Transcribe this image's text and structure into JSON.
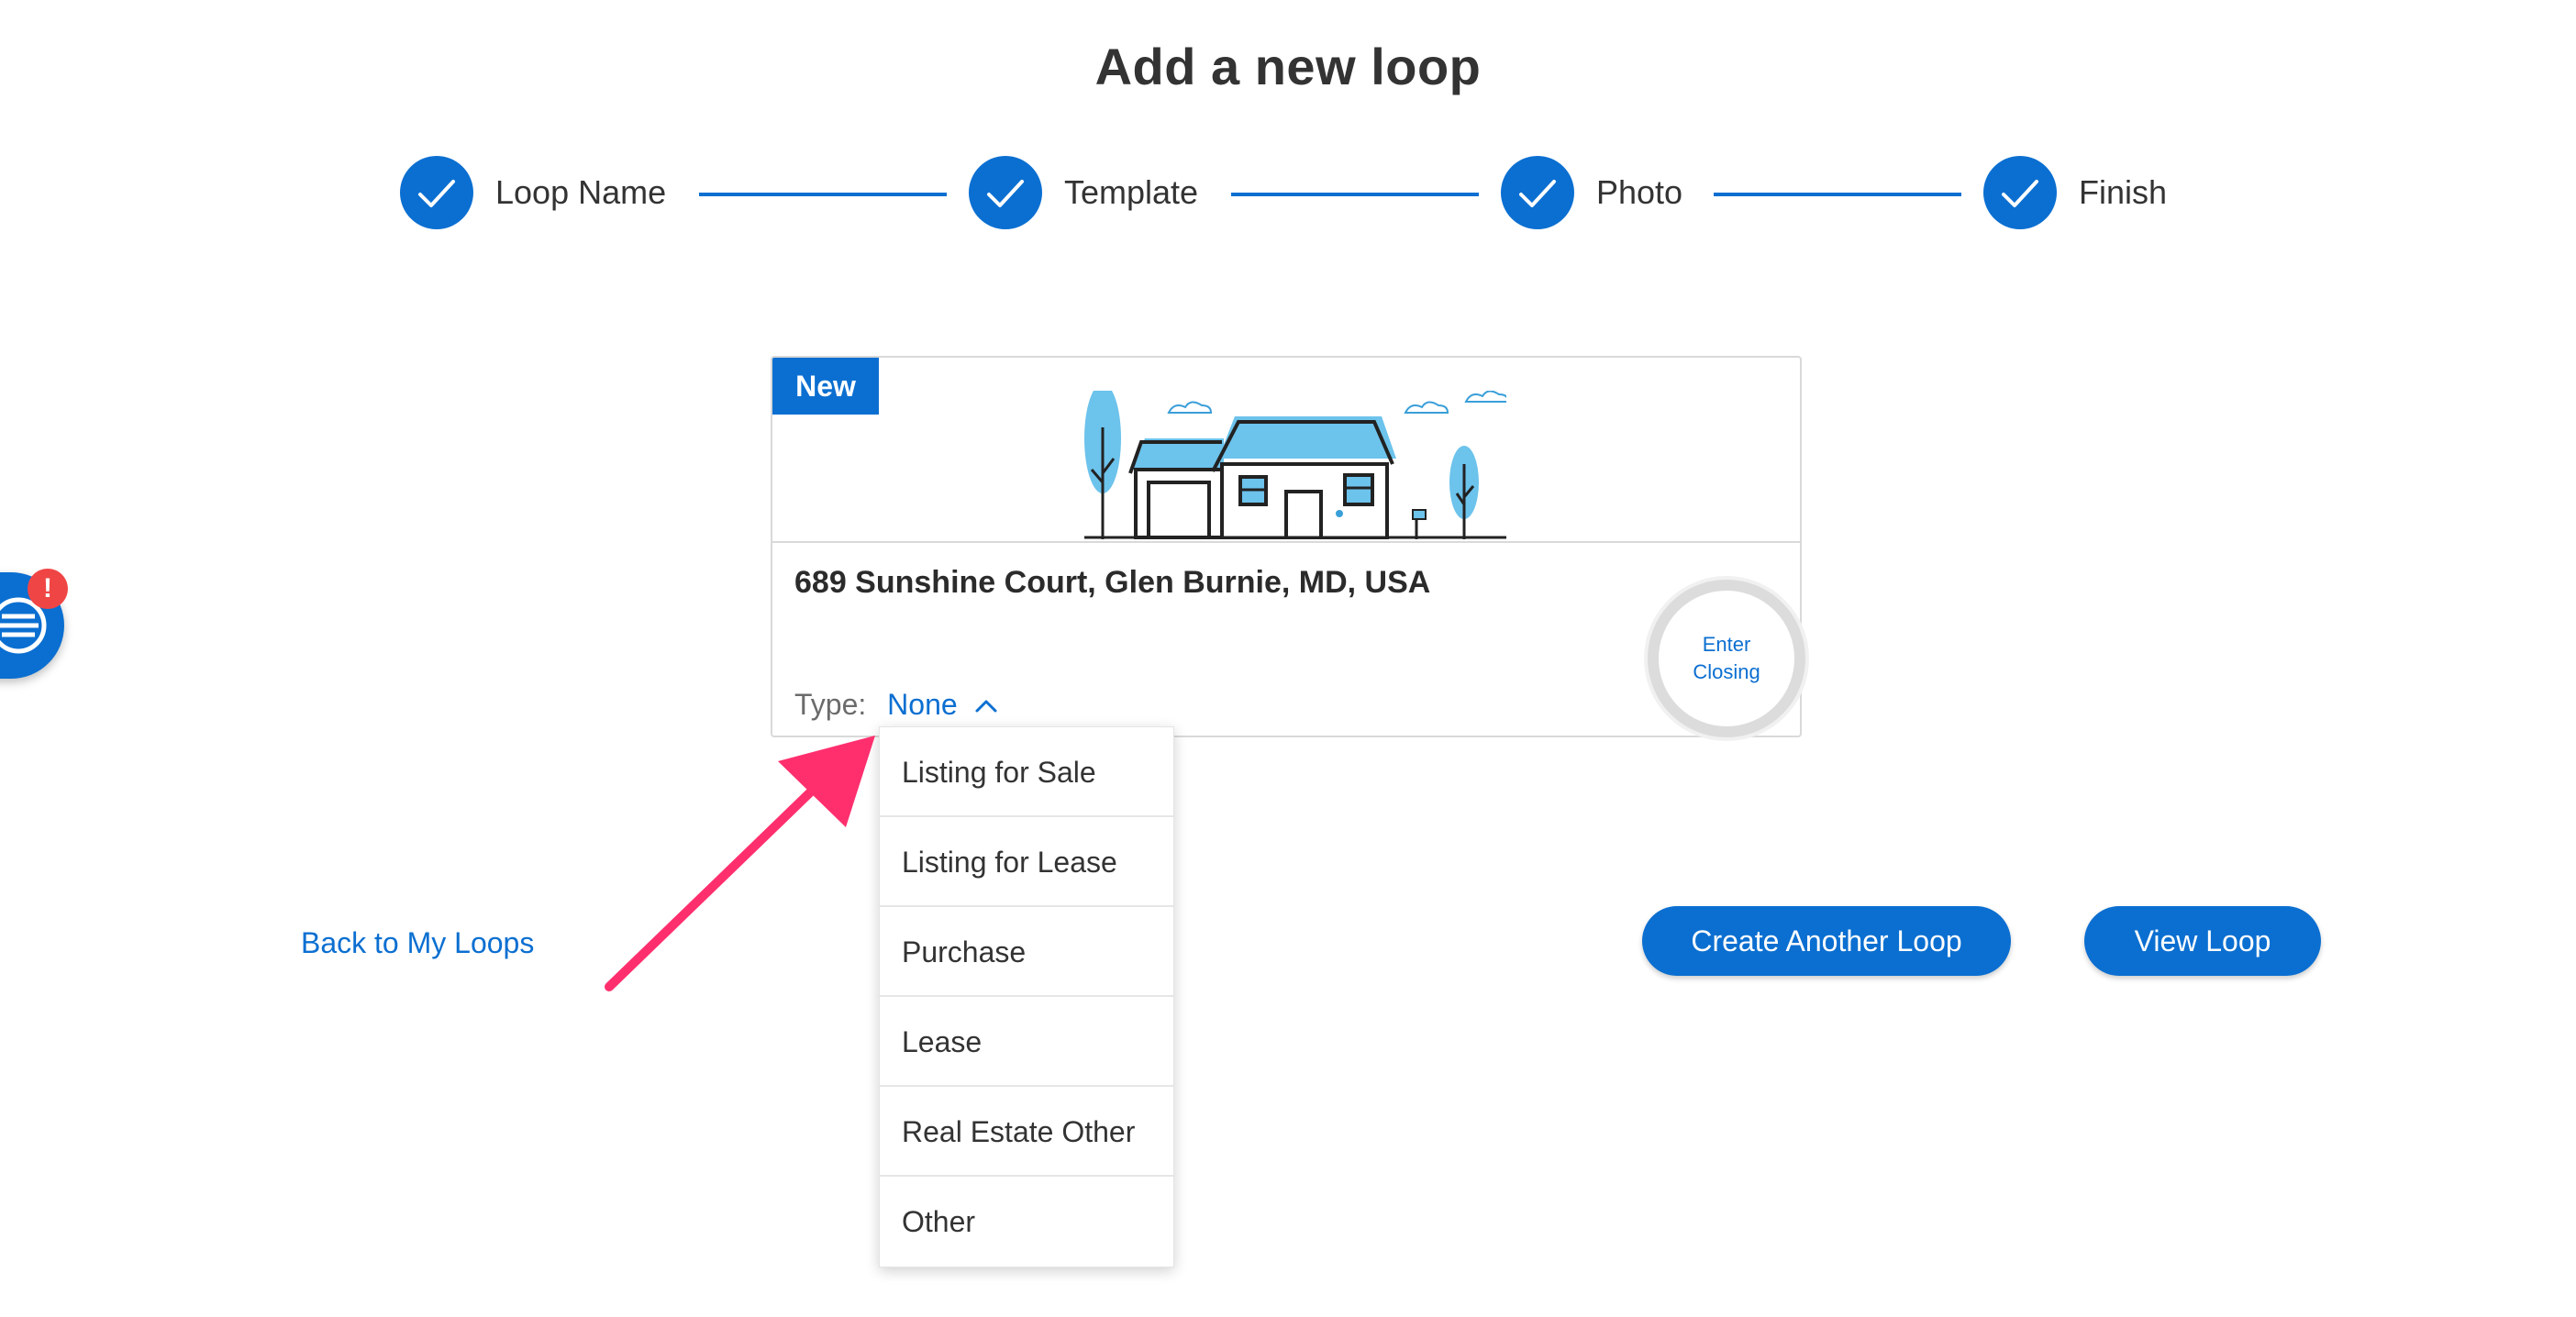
{
  "page": {
    "title": "Add a new loop"
  },
  "steps": [
    {
      "label": "Loop Name",
      "completed": true
    },
    {
      "label": "Template",
      "completed": true
    },
    {
      "label": "Photo",
      "completed": true
    },
    {
      "label": "Finish",
      "completed": true
    }
  ],
  "card": {
    "badge": "New",
    "address": "689 Sunshine Court, Glen Burnie, MD, USA",
    "type_label": "Type:",
    "type_value": "None",
    "enter_closing_line1": "Enter",
    "enter_closing_line2": "Closing"
  },
  "type_dropdown": {
    "options": [
      "Listing for Sale",
      "Listing for Lease",
      "Purchase",
      "Lease",
      "Real Estate Other",
      "Other"
    ]
  },
  "actions": {
    "back_link": "Back to My Loops",
    "create_another": "Create Another Loop",
    "view_loop": "View Loop"
  },
  "side_menu": {
    "alert_badge": "!"
  },
  "colors": {
    "accent": "#0b6fd1",
    "annotation_arrow": "#ff2f6e",
    "alert": "#f04545"
  },
  "icons": {
    "step": "checkmark-icon",
    "type_toggle": "chevron-up-icon",
    "side_menu": "menu-list-icon"
  }
}
